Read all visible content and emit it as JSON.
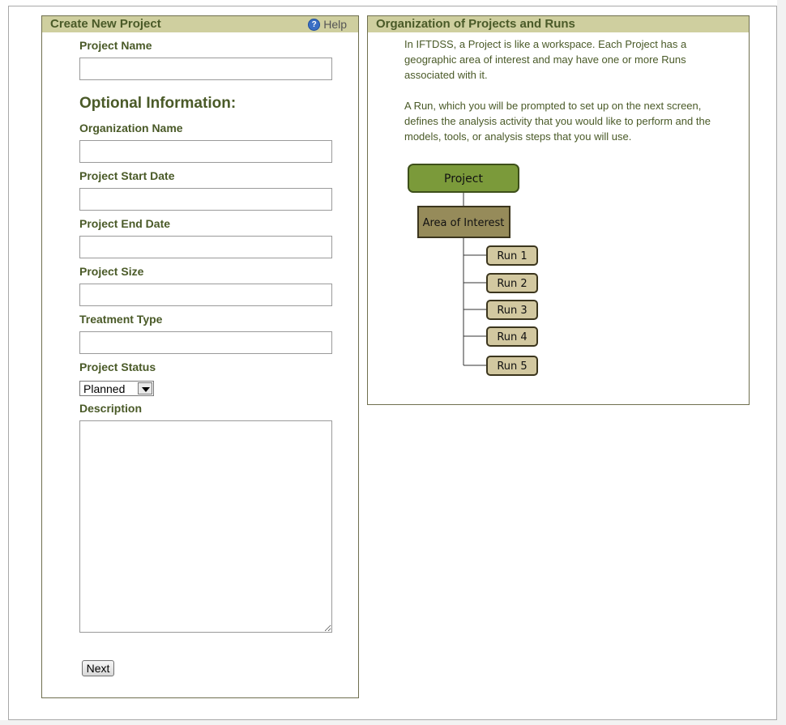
{
  "create_panel": {
    "title": "Create New Project",
    "help_label": "Help",
    "project_name_label": "Project Name",
    "project_name_value": "",
    "optional_heading": "Optional Information:",
    "organization_label": "Organization Name",
    "organization_value": "",
    "start_date_label": "Project Start Date",
    "start_date_value": "",
    "end_date_label": "Project End Date",
    "end_date_value": "",
    "size_label": "Project Size",
    "size_value": "",
    "treatment_label": "Treatment Type",
    "treatment_value": "",
    "status_label": "Project Status",
    "status_selected": "Planned",
    "description_label": "Description",
    "description_value": "",
    "next_label": "Next"
  },
  "info_panel": {
    "title": "Organization of Projects and Runs",
    "paragraph1": "In IFTDSS, a Project is like a workspace. Each Project has a geographic area of interest and may have one or more Runs associated with it.",
    "paragraph2": "A Run, which you will be prompted to set up on the next screen, defines the analysis activity that you would like to perform and the models, tools, or analysis steps that you will use.",
    "diagram": {
      "project": "Project",
      "area": "Area of Interest",
      "runs": [
        "Run 1",
        "Run 2",
        "Run 3",
        "Run 4",
        "Run 5"
      ]
    }
  },
  "colors": {
    "header_bg": "#cfcf9f",
    "text_olive": "#4a5a28",
    "project_box": "#7b9a3a",
    "area_box": "#968b5a",
    "run_box": "#d2c8a0"
  }
}
